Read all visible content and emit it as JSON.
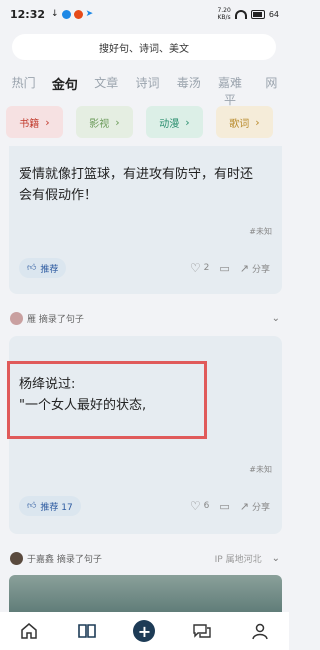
{
  "status_bar": {
    "time": "12:32",
    "speed": "7.20\nKB/s",
    "battery": "64"
  },
  "search": {
    "placeholder": "搜好句、诗词、美文"
  },
  "tabs": [
    {
      "label": "热门"
    },
    {
      "label": "金句"
    },
    {
      "label": "文章"
    },
    {
      "label": "诗词"
    },
    {
      "label": "毒汤"
    },
    {
      "label": "嘉难平"
    },
    {
      "label": "网"
    }
  ],
  "categories": [
    {
      "label": "书籍",
      "color": "#c0392b",
      "bg": "#f6e1e2"
    },
    {
      "label": "影视",
      "color": "#6a9a58",
      "bg": "#e5eee2"
    },
    {
      "label": "动漫",
      "color": "#2b8f6f",
      "bg": "#dcefe7"
    },
    {
      "label": "歌词",
      "color": "#b88a2a",
      "bg": "#f5ecd9"
    }
  ],
  "post1": {
    "quote_line1": "爱情就像打篮球，有进攻有防守，有时还",
    "quote_line2": "会有假动作！",
    "tag": "#未知",
    "recommend_label": "推荐",
    "likes": "2",
    "share_label": "分享"
  },
  "post2": {
    "author": "雁 摘录了句子",
    "quote_line1": "杨绛说过:",
    "quote_line2": "\"一个女人最好的状态,",
    "tag": "#未知",
    "recommend_label": "推荐 17",
    "likes": "6",
    "share_label": "分享"
  },
  "post3": {
    "author": "于嘉鑫 摘录了句子",
    "location": "IP 属地河北"
  }
}
